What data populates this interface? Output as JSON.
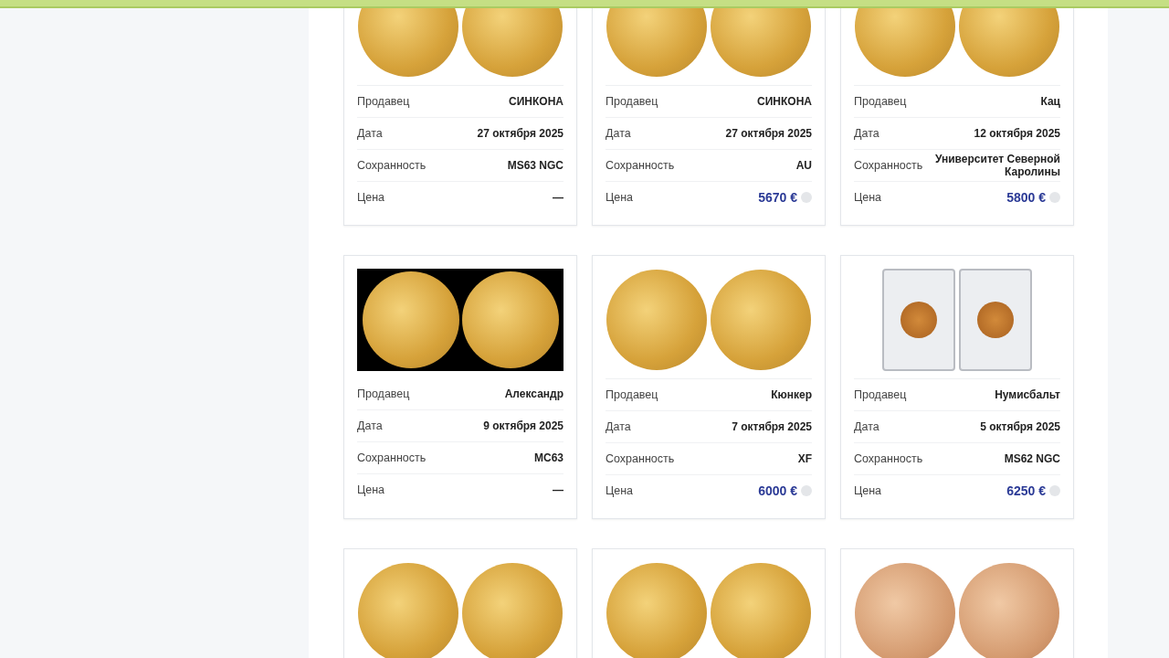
{
  "lots": [
    {
      "kind": "coins",
      "rows": [
        {
          "label": "Продавец",
          "value": "СИНКОНА"
        },
        {
          "label": "Дата",
          "value": "27 октября 2025"
        },
        {
          "label": "Сохранность",
          "value": "MS63 NGC"
        }
      ],
      "price": {
        "label": "Цена",
        "value": "—",
        "info": false
      }
    },
    {
      "kind": "coins",
      "rows": [
        {
          "label": "Продавец",
          "value": "СИНКОНА"
        },
        {
          "label": "Дата",
          "value": "27 октября 2025"
        },
        {
          "label": "Сохранность",
          "value": "AU"
        }
      ],
      "price": {
        "label": "Цена",
        "value": "5670 €",
        "info": true
      }
    },
    {
      "kind": "coins",
      "rows": [
        {
          "label": "Продавец",
          "value": "Кац"
        },
        {
          "label": "Дата",
          "value": "12 октября 2025"
        },
        {
          "label": "Сохранность",
          "value": "Университет Северной Каролины"
        }
      ],
      "price": {
        "label": "Цена",
        "value": "5800 €",
        "info": true
      }
    },
    {
      "kind": "dark",
      "rows": [
        {
          "label": "Продавец",
          "value": "Александр"
        },
        {
          "label": "Дата",
          "value": "9 октября 2025"
        },
        {
          "label": "Сохранность",
          "value": "МС63"
        }
      ],
      "price": {
        "label": "Цена",
        "value": "—",
        "info": false
      }
    },
    {
      "kind": "coins",
      "rows": [
        {
          "label": "Продавец",
          "value": "Кюнкер"
        },
        {
          "label": "Дата",
          "value": "7 октября 2025"
        },
        {
          "label": "Сохранность",
          "value": "XF"
        }
      ],
      "price": {
        "label": "Цена",
        "value": "6000 €",
        "info": true
      }
    },
    {
      "kind": "slab",
      "rows": [
        {
          "label": "Продавец",
          "value": "Нумисбальт"
        },
        {
          "label": "Дата",
          "value": "5 октября 2025"
        },
        {
          "label": "Сохранность",
          "value": "MS62 NGC"
        }
      ],
      "price": {
        "label": "Цена",
        "value": "6250 €",
        "info": true
      }
    },
    {
      "kind": "coins"
    },
    {
      "kind": "coins"
    },
    {
      "kind": "pale"
    }
  ]
}
